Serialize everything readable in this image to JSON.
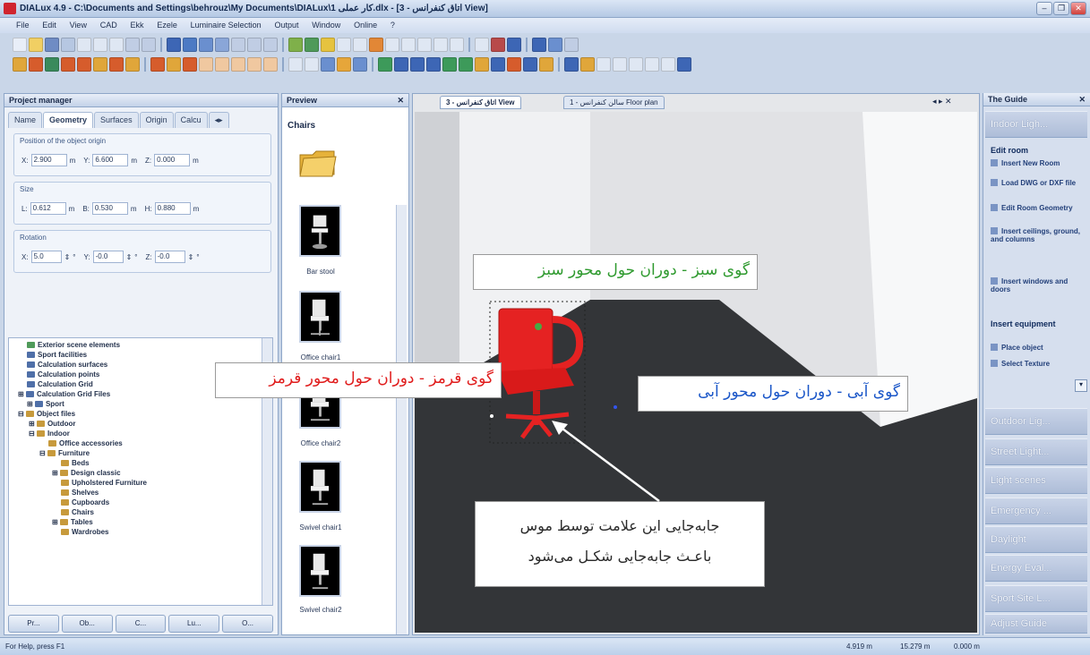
{
  "window": {
    "title": "DIALux 4.9 - C:\\Documents and Settings\\behrouz\\My Documents\\DIALux\\1 کار عملی.dlx - [3 - اتاق کنفرانس View]"
  },
  "menu": [
    "File",
    "Edit",
    "View",
    "CAD",
    "Ekk",
    "Ezele",
    "Luminaire Selection",
    "Output",
    "Window",
    "Online",
    "?"
  ],
  "project_manager": {
    "header": "Project manager",
    "tabs": [
      "Name",
      "Geometry",
      "Surfaces",
      "Origin",
      "Calcu"
    ],
    "position_caption": "Position of the object origin",
    "position": {
      "x": "2.900",
      "y": "6.600",
      "z": "0.000",
      "unit": "m"
    },
    "size_caption": "Size",
    "size": {
      "l": "0.612",
      "b": "0.530",
      "h": "0.880",
      "unit": "m"
    },
    "rotation_caption": "Rotation",
    "rotation": {
      "x": "5.0",
      "y": "-0.0",
      "z": "-0.0",
      "unit": "°"
    },
    "tree": [
      "Exterior scene elements",
      "Sport facilities",
      "Calculation surfaces",
      "Calculation points",
      "Calculation Grid",
      "Calculation Grid Files",
      "Sport",
      "Object files",
      "Outdoor",
      "Indoor",
      "Office accessories",
      "Furniture",
      "Beds",
      "Design classic",
      "Upholstered Furniture",
      "Shelves",
      "Cupboards",
      "Chairs",
      "Tables",
      "Wardrobes"
    ],
    "bottom_tabs": [
      "Pr...",
      "Ob...",
      "C...",
      "Lu...",
      "O..."
    ]
  },
  "preview": {
    "header": "Preview",
    "category": "Chairs",
    "items": [
      "Bar stool",
      "Office chair1",
      "Office chair2",
      "Swivel chair1",
      "Swivel chair2"
    ]
  },
  "viewport": {
    "tabs": [
      "3 - اتاق کنفرانس View",
      "1 - سالن کنفرانس Floor plan"
    ]
  },
  "guide": {
    "header": "The Guide",
    "top_button": "Indoor Ligh...",
    "edit_room_title": "Edit room",
    "tasks": [
      "Insert New Room",
      "Load DWG or DXF file",
      "Edit Room Geometry",
      "Insert ceilings, ground, and columns",
      "Insert windows and doors"
    ],
    "insert_title": "Insert equipment",
    "tasks2": [
      "Place object",
      "Select Texture"
    ],
    "sections": [
      "Outdoor Lig...",
      "Street Light...",
      "Light scenes",
      "Emergency ...",
      "Daylight",
      "Energy Eval...",
      "Sport Site L...",
      "Adjust Guide"
    ]
  },
  "status": {
    "help": "For Help, press F1",
    "x": "4.919 m",
    "y": "15.279 m",
    "z": "0.000 m"
  },
  "annotations": {
    "green": "گوی سبز - دوران حول محور سبز",
    "red": "گوی قرمز - دوران حول محور قرمز",
    "blue": "گوی آبی - دوران حول محور آبی",
    "move_line1": "جابه‌جایی این علامت توسط موس",
    "move_line2": "باعـث جابه‌جایی شکـل می‌شود"
  }
}
